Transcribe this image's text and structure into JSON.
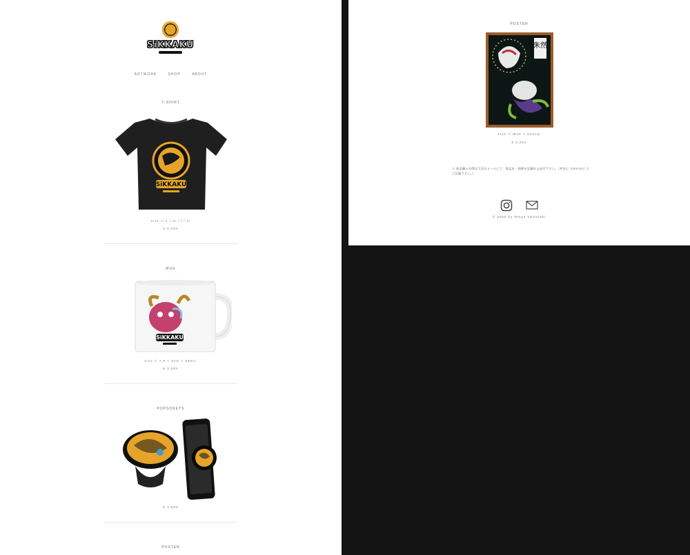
{
  "site": {
    "logo_text": "SiKKAKU"
  },
  "nav": [
    "ARTWORK",
    "SHOP",
    "ABOUT"
  ],
  "products": {
    "tshirt": {
      "title": "T-SHIRT",
      "size": "size // s / m / l / xl",
      "price": "¥ 5,000",
      "print_text": "SiKKAKU"
    },
    "mug": {
      "title": "MUG",
      "size": "size // 7.8 × 9cm × 300cc",
      "price": "¥ 3,500",
      "print_text": "SiKKAKU"
    },
    "popsockets": {
      "title": "POPSOKETS",
      "price": "¥ 3,500"
    },
    "poster_left": {
      "title": "POSTER"
    },
    "poster": {
      "title": "POSTER",
      "size": "size // W23 × H33cm",
      "price": "¥ 3,000",
      "kanji": "朱然"
    }
  },
  "note": "※ 商品購入の際は下記のメールにて、商品名・個数を記載の上送付下さい。（件名に 'SIKKAKU' とご記載下さい。）",
  "footer": {
    "copyright": "© 2020 by Tenga Yamazaki"
  },
  "colors": {
    "gold": "#e6a52a",
    "page_bg": "#141414",
    "panel_bg": "#ffffff"
  }
}
